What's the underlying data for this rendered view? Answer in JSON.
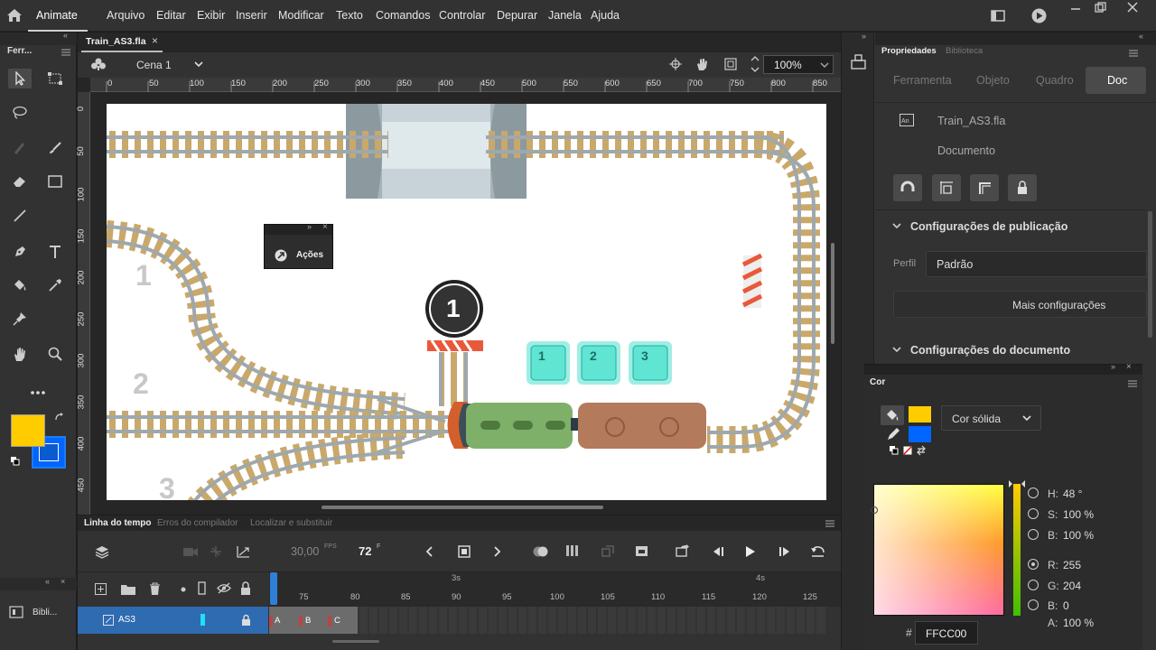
{
  "app": {
    "name": "Animate"
  },
  "menu": [
    "Arquivo",
    "Editar",
    "Exibir",
    "Inserir",
    "Modificar",
    "Texto",
    "Comandos",
    "Controlar",
    "Depurar",
    "Janela",
    "Ajuda"
  ],
  "tools": {
    "header": "Ferr..."
  },
  "document": {
    "tab": "Train_AS3.fla",
    "close": "×"
  },
  "scene": {
    "name": "Cena 1",
    "zoom": "100%"
  },
  "ruler": {
    "top": [
      "0",
      "50",
      "100",
      "150",
      "200",
      "250",
      "300",
      "350",
      "400",
      "450",
      "500",
      "550",
      "600",
      "650",
      "700",
      "750",
      "800",
      "850"
    ],
    "left": [
      "0",
      "50",
      "100",
      "150",
      "200",
      "250",
      "300",
      "350",
      "400",
      "450"
    ]
  },
  "stage": {
    "rowNumbers": [
      "1",
      "2",
      "3"
    ],
    "signalNumber": "1",
    "buttons": [
      "1",
      "2",
      "3"
    ],
    "actionsPanel": {
      "label": "Ações"
    }
  },
  "timeline": {
    "tabs": [
      "Linha do tempo",
      "Erros do compilador",
      "Localizar e substituir"
    ],
    "fps": "30,00",
    "fpsUnit": "FPS",
    "frame": "72",
    "frameUnit": "F",
    "secondMarks": [
      "3s",
      "4s"
    ],
    "frameNumbers": [
      "75",
      "80",
      "85",
      "90",
      "95",
      "100",
      "105",
      "110",
      "115",
      "120",
      "125"
    ],
    "layer": {
      "name": "AS3"
    },
    "frameLabels": [
      "A",
      "B",
      "C"
    ]
  },
  "properties": {
    "tabs": [
      "Propriedades",
      "Biblioteca"
    ],
    "subtabs": [
      "Ferramenta",
      "Objeto",
      "Quadro",
      "Doc"
    ],
    "docName": "Train_AS3.fla",
    "docType": "Documento",
    "publishSection": "Configurações de publicação",
    "profileLabel": "Perfil",
    "profileValue": "Padrão",
    "moreSettings": "Mais configurações",
    "docSection": "Configurações do documento"
  },
  "libraryMini": {
    "label": "Bibli..."
  },
  "color": {
    "panelTitle": "Cor",
    "fillType": "Cor sólida",
    "strokeColor": "#FFCC00",
    "fillColor": "#0066FF",
    "hLabel": "H:",
    "hValue": "48 °",
    "sLabel": "S:",
    "sValue": "100 %",
    "bLabel": "B:",
    "bValue": "100 %",
    "rLabel": "R:",
    "rValue": "255",
    "gLabel": "G:",
    "gValue": "204",
    "b2Label": "B:",
    "b2Value": "0",
    "aLabel": "A:",
    "aValue": "100 %",
    "hexLabel": "#",
    "hexValue": "FFCC00"
  }
}
